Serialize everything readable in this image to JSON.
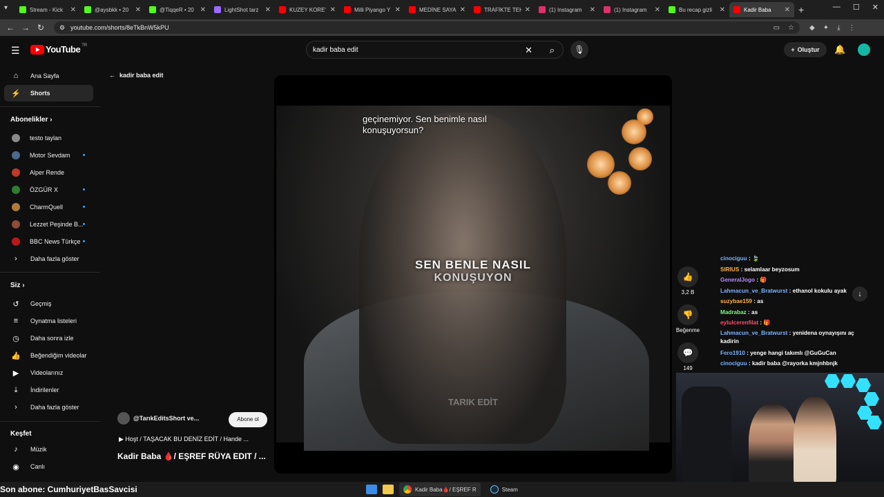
{
  "browser": {
    "tabs": [
      {
        "label": "Stream - Kick",
        "color": "#53fc18"
      },
      {
        "label": "@aysbkk • 20",
        "color": "#53fc18"
      },
      {
        "label": "@TiqqeR • 20",
        "color": "#53fc18"
      },
      {
        "label": "LightShot tarz",
        "color": "#9b6bff"
      },
      {
        "label": "KUZEY KORE'",
        "color": "#ff0000"
      },
      {
        "label": "Milli Piyango Y",
        "color": "#ff0000"
      },
      {
        "label": "MEDİNE SAYA",
        "color": "#ff0000"
      },
      {
        "label": "TRAFİKTE TEH",
        "color": "#ff0000"
      },
      {
        "label": "(1) Instagram",
        "color": "#e1306c"
      },
      {
        "label": "(1) Instagram",
        "color": "#e1306c"
      },
      {
        "label": "Bu recap gizli",
        "color": "#53fc18"
      },
      {
        "label": "Kadir Baba",
        "color": "#ff0000",
        "active": true
      }
    ],
    "url": "youtube.com/shorts/8eTkBnW5kPU"
  },
  "header": {
    "logo_text": "YouTube",
    "country": "TR",
    "search_value": "kadir baba edit",
    "create_label": "Oluştur"
  },
  "sidebar": {
    "main": [
      {
        "label": "Ana Sayfa",
        "icon": "home-icon"
      },
      {
        "label": "Shorts",
        "icon": "shorts-icon",
        "active": true
      }
    ],
    "subs_heading": "Abonelikler",
    "subs": [
      {
        "label": "testo taylan",
        "color": "#8a8a8a"
      },
      {
        "label": "Motor Sevdam",
        "color": "#4a6a8a"
      },
      {
        "label": "Alper Rende",
        "color": "#c0392b"
      },
      {
        "label": "ÖZGÜR X",
        "color": "#2e7d32"
      },
      {
        "label": "CharmQuell",
        "color": "#b07a3a"
      },
      {
        "label": "Lezzet Peşinde B...",
        "color": "#8e4a3a"
      },
      {
        "label": "BBC News Türkçe",
        "color": "#bb1919"
      }
    ],
    "subs_more": "Daha fazla göster",
    "you_heading": "Siz",
    "you": [
      {
        "label": "Geçmiş",
        "icon": "history-icon"
      },
      {
        "label": "Oynatma listeleri",
        "icon": "playlists-icon"
      },
      {
        "label": "Daha sonra izle",
        "icon": "watch-later-icon"
      },
      {
        "label": "Beğendiğim videolar",
        "icon": "liked-icon"
      },
      {
        "label": "Videolarınız",
        "icon": "your-videos-icon"
      },
      {
        "label": "İndirilenler",
        "icon": "downloads-icon"
      }
    ],
    "you_more": "Daha fazla göster",
    "explore_heading": "Keşfet",
    "explore": [
      {
        "label": "Müzik",
        "icon": "music-icon"
      },
      {
        "label": "Canlı",
        "icon": "live-icon"
      }
    ]
  },
  "shorts": {
    "back_label": "kadir baba edit",
    "subtitle": "geçinemiyor. Sen benimle nasıl konuşuyorsun?",
    "caption_line1": "SEN BENLE NASIL",
    "caption_line2": "KONUŞUYON",
    "watermark": "TARIK EDİT",
    "channel": "@TarıkEditsShort ve...",
    "subscribe_label": "Abone ol",
    "music": "Hoşt / TAŞACAK BU DENİZ EDİT / Hande ...",
    "title": "Kadir Baba 🩸/ EŞREF RÜYA EDIT / ...",
    "likes": "3,2 B",
    "dislike_label": "Beğenme",
    "comments": "149"
  },
  "chat": [
    {
      "user": "cinociguu",
      "user_color": "#7cb3ff",
      "msg": "🍃"
    },
    {
      "user": "SIRIUS",
      "user_color": "#ffb347",
      "msg": "selamlaar beyzosum"
    },
    {
      "user": "GeneralJogo",
      "user_color": "#b58cff",
      "msg": "🎁"
    },
    {
      "user": "Lahmacun_ve_Bratwurst",
      "user_color": "#7cb3ff",
      "msg": "ethanol kokulu ayak"
    },
    {
      "user": "suzybae159",
      "user_color": "#ffb347",
      "msg": "as"
    },
    {
      "user": "Madrabaz",
      "user_color": "#7cff7c",
      "msg": "as"
    },
    {
      "user": "eylulcerenfilat",
      "user_color": "#ff4f6d",
      "msg": "🎁"
    },
    {
      "user": "Lahmacun_ve_Bratwurst",
      "user_color": "#7cb3ff",
      "msg": "yenidena oynayışını aç kadirin",
      "wrap": true
    },
    {
      "user": "Fero1910",
      "user_color": "#7cb3ff",
      "msg": "yenge hangi takımlı @GuGuCan"
    },
    {
      "user": "cinociguu",
      "user_color": "#7cb3ff",
      "msg": "kadir baba @rayorka kmjnhbnjk"
    }
  ],
  "footer": {
    "last_sub": "Son abone: CumhuriyetBasSavcisi",
    "taskbar_apps": [
      {
        "label": "Kadir Baba🩸/ EŞREF R",
        "active": true
      },
      {
        "label": "Steam"
      }
    ]
  }
}
